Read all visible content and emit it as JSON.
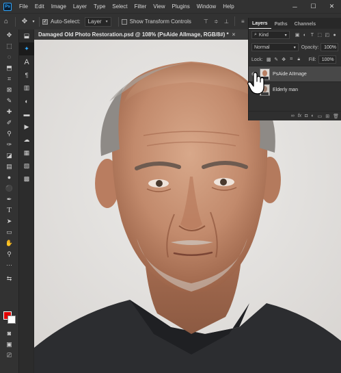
{
  "app": {
    "logo": "Ps"
  },
  "menu": [
    "File",
    "Edit",
    "Image",
    "Layer",
    "Type",
    "Select",
    "Filter",
    "View",
    "Plugins",
    "Window",
    "Help"
  ],
  "window_controls": {
    "minimize": "─",
    "maximize": "☐",
    "close": "✕"
  },
  "options_bar": {
    "auto_select_label": "Auto-Select:",
    "auto_select_checked": true,
    "layer_dropdown": "Layer",
    "show_transform_label": "Show Transform Controls",
    "show_transform_checked": false
  },
  "document": {
    "tab_title": "Damaged Old Photo Restoration.psd @ 108% (PsAide AIImage, RGB/8#) *",
    "close": "×"
  },
  "colors": {
    "foreground": "#e00000",
    "background": "#ffffff",
    "accent": "#31a8ff"
  },
  "layers_panel": {
    "tabs": [
      "Layers",
      "Paths",
      "Channels"
    ],
    "active_tab": "Layers",
    "filter_label": "Kind",
    "blend_mode": "Normal",
    "opacity_label": "Opacity:",
    "opacity_value": "100%",
    "lock_label": "Lock:",
    "fill_label": "Fill:",
    "fill_value": "100%",
    "layers": [
      {
        "name": "PsAide AIImage",
        "selected": true,
        "visible": true
      },
      {
        "name": "Elderly man",
        "selected": false,
        "visible": true
      }
    ]
  }
}
